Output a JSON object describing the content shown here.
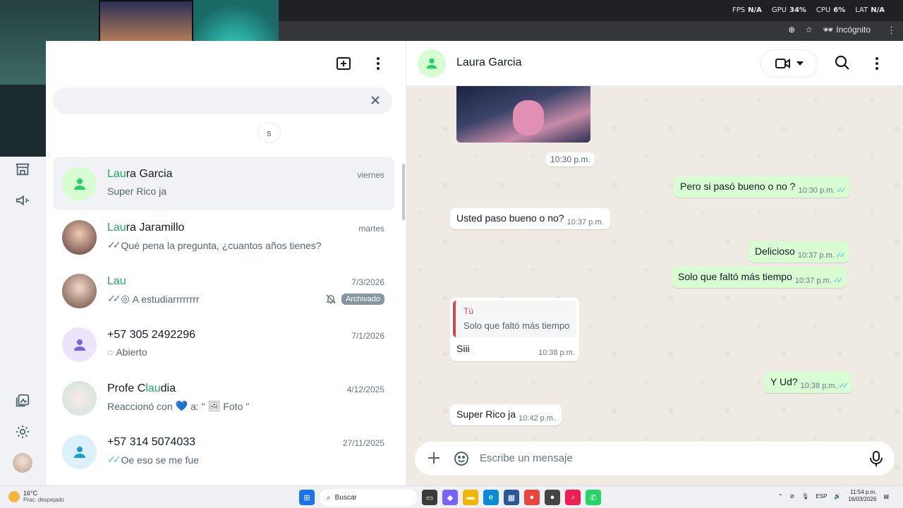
{
  "overlay": {
    "fps_label": "FPS",
    "fps": "N/A",
    "gpu_label": "GPU",
    "gpu": "34%",
    "cpu_label": "CPU",
    "cpu": "6%",
    "lat_label": "LAT",
    "lat": "N/A"
  },
  "browser": {
    "incognito": "Incógnito"
  },
  "search": {
    "clear_icon": "close-icon"
  },
  "filter_chip": "s",
  "chats": [
    {
      "name_hl": "Lau",
      "name_rest": "ra Garcia",
      "time": "viernes",
      "preview": "Super Rico ja",
      "avatar": "default-person",
      "avatar_color": "#25d366",
      "avatar_bg": "#d9fdd3",
      "active": true
    },
    {
      "name_hl": "Lau",
      "name_rest": "ra Jaramillo",
      "time": "martes",
      "preview": "Qué pena la pregunta, ¿cuantos años tienes?",
      "ticks": "read-grey",
      "avatar": "photo"
    },
    {
      "name_hl": "Lau",
      "name_rest": "",
      "time": "7/3/2026",
      "preview": "A estudiarrrrrrrr",
      "ticks": "read-grey",
      "status_icon": "status-icon",
      "muted": true,
      "badge": "Archivado",
      "avatar": "photo"
    },
    {
      "name_pre": "",
      "name_hl": "",
      "name_rest": "+57 305 2492296",
      "time": "7/1/2026",
      "preview": "Abierto",
      "status_icon": "loading-circle-icon",
      "avatar": "default-person",
      "avatar_color": "#7c5ce8",
      "avatar_bg": "#ebe4fb"
    },
    {
      "name_pre": "Profe C",
      "name_hl": "lau",
      "name_rest": "dia",
      "time": "4/12/2025",
      "preview_pre": "Reaccionó con ",
      "preview_emoji": "💙",
      "preview_post": " a: \"",
      "preview_media": "Foto",
      "preview_end": "\"",
      "avatar": "photo"
    },
    {
      "name_pre": "",
      "name_hl": "",
      "name_rest": "+57 314 5074033",
      "time": "27/11/2025",
      "preview": "Oe eso se me fue",
      "ticks": "read-blue",
      "avatar": "default-person",
      "avatar_color": "#1b9bd7",
      "avatar_bg": "#dcf1fb"
    }
  ],
  "conversation": {
    "contact": "Laura Garcia",
    "image_time": "10:30 p.m.",
    "messages": [
      {
        "dir": "out",
        "text": "Pero si pasó bueno o no ?",
        "time": "10:30 p.m."
      },
      {
        "dir": "in",
        "text": "Usted paso bueno o no?",
        "time": "10:37 p.m."
      },
      {
        "dir": "out",
        "text": "Delicioso",
        "time": "10:37 p.m."
      },
      {
        "dir": "out",
        "text": "Solo que faltó más tiempo",
        "time": "10:37 p.m."
      },
      {
        "dir": "out",
        "text": "Y Ud?",
        "time": "10:38 p.m."
      },
      {
        "dir": "in",
        "text": "Super Rico ja",
        "time": "10:42 p.m."
      }
    ],
    "quoted": {
      "author": "Tú",
      "quoted_text": "Solo que faltó más tiempo",
      "text": "Siii",
      "time": "10:38 p.m."
    },
    "composer_placeholder": "Escribe un mensaje"
  },
  "taskbar": {
    "temp": "16°C",
    "weather": "Prac. despejado",
    "search": "Buscar",
    "lang": "ESP",
    "time": "11:54 p.m.",
    "date": "16/03/2026"
  }
}
